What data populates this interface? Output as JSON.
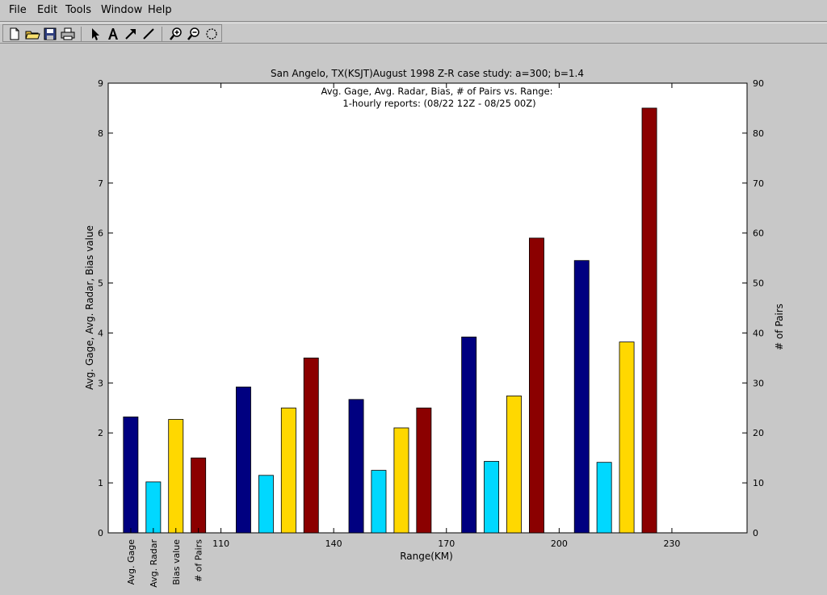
{
  "window": {
    "menus": [
      "File",
      "Edit",
      "Tools",
      "Window",
      "Help"
    ]
  },
  "toolbar": {
    "tools": [
      "new-file-icon",
      "open-folder-icon",
      "save-icon",
      "print-icon",
      "select-arrow-icon",
      "text-tool-icon",
      "arrow-tool-icon",
      "line-tool-icon",
      "zoom-in-icon",
      "zoom-out-icon",
      "rotate-icon"
    ]
  },
  "chart_data": {
    "type": "bar",
    "title": "San Angelo, TX(KSJT)August 1998 Z-R case study: a=300; b=1.4",
    "subtitle_lines": [
      "Avg. Gage, Avg. Radar, Bias, # of Pairs vs. Range:",
      "1-hourly reports: (08/22 12Z - 08/25 00Z)"
    ],
    "xlabel": "Range(KM)",
    "ylabel_left": "Avg. Gage, Avg. Radar, Bias value",
    "ylabel_right": "# of Pairs",
    "xlim": [
      80,
      250
    ],
    "x_ticks": [
      110,
      140,
      170,
      200,
      230
    ],
    "ylim_left": [
      0,
      9
    ],
    "ylim_right": [
      0,
      90
    ],
    "groups": [
      95,
      125,
      155,
      185,
      215
    ],
    "series_order": [
      "Avg. Gage",
      "Avg. Radar",
      "Bias value",
      "# of Pairs"
    ],
    "bar_labels": [
      "Avg. Gage",
      "Avg. Radar",
      "Bias value",
      "# of Pairs"
    ],
    "series": [
      {
        "name": "Avg. Gage",
        "axis": "left",
        "color": "#000080",
        "values": [
          2.32,
          2.92,
          2.67,
          3.92,
          5.45
        ]
      },
      {
        "name": "Avg. Radar",
        "axis": "left",
        "color": "#00d8ff",
        "values": [
          1.02,
          1.15,
          1.25,
          1.43,
          1.41
        ]
      },
      {
        "name": "Bias value",
        "axis": "left",
        "color": "#ffd800",
        "values": [
          2.27,
          2.5,
          2.1,
          2.74,
          3.82
        ]
      },
      {
        "name": "# of Pairs",
        "axis": "right",
        "color": "#8b0000",
        "values": [
          15,
          35,
          25,
          59,
          85
        ]
      }
    ],
    "grid": false,
    "legend": "none"
  }
}
